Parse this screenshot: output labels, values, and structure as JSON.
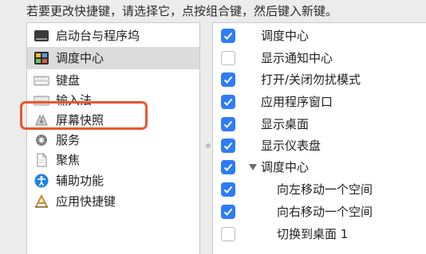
{
  "instruction": "若要更改快捷键，请选择它，点按组合键，然后键入新键。",
  "categories": [
    {
      "label": "启动台与程序坞",
      "icon": "launchpad-dock-icon",
      "selected": false
    },
    {
      "label": "调度中心",
      "icon": "mission-control-icon",
      "selected": true
    },
    {
      "label": "键盘",
      "icon": "keyboard-icon",
      "selected": false
    },
    {
      "label": "输入法",
      "icon": "input-source-icon",
      "selected": false
    },
    {
      "label": "屏幕快照",
      "icon": "screenshot-icon",
      "selected": false
    },
    {
      "label": "服务",
      "icon": "gear-icon",
      "selected": false
    },
    {
      "label": "聚焦",
      "icon": "spotlight-doc-icon",
      "selected": false
    },
    {
      "label": "辅助功能",
      "icon": "accessibility-icon",
      "selected": false
    },
    {
      "label": "应用快捷键",
      "icon": "app-shortcuts-icon",
      "selected": false
    }
  ],
  "shortcuts": [
    {
      "label": "调度中心",
      "checked": true
    },
    {
      "label": "显示通知中心",
      "checked": false
    },
    {
      "label": "打开/关闭勿扰模式",
      "checked": true
    },
    {
      "label": "应用程序窗口",
      "checked": true
    },
    {
      "label": "显示桌面",
      "checked": true
    },
    {
      "label": "显示仪表盘",
      "checked": true
    },
    {
      "label": "调度中心",
      "checked": true,
      "group": true,
      "expanded": true
    },
    {
      "label": "向左移动一个空间",
      "checked": true
    },
    {
      "label": "向右移动一个空间",
      "checked": true
    },
    {
      "label": "切换到桌面 1",
      "checked": false
    }
  ],
  "colors": {
    "accent": "#2e7cf6",
    "highlight": "#e8572f",
    "selected_row": "#dcdcdc"
  }
}
